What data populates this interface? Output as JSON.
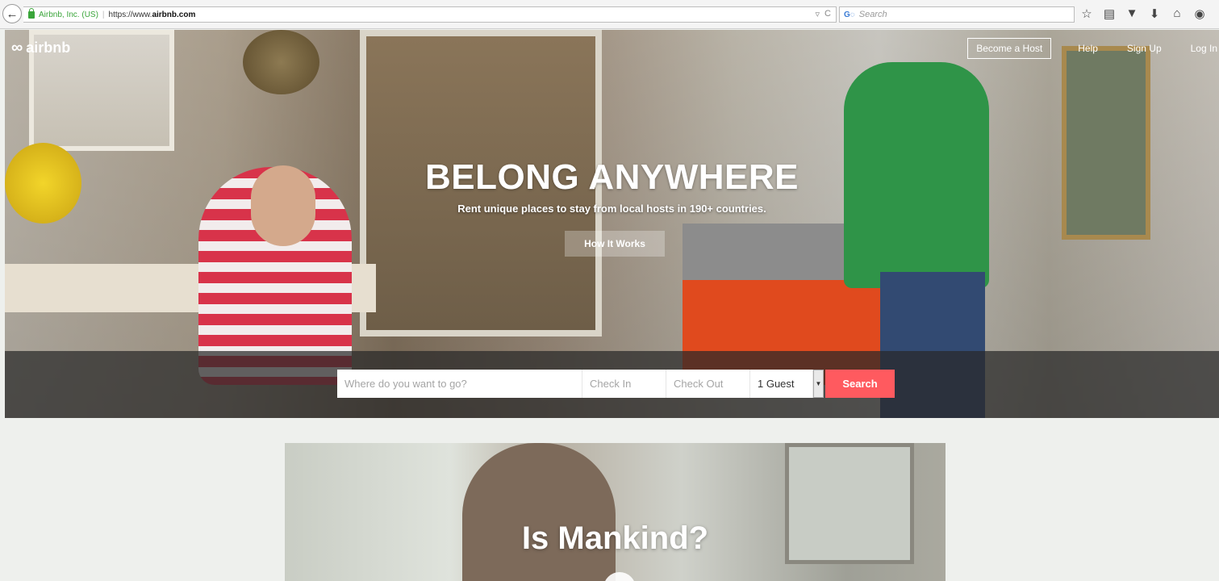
{
  "browser": {
    "site_identity": "Airbnb, Inc. (US)",
    "url_prefix": "https://www.",
    "url_domain": "airbnb.com",
    "search_placeholder": "Search",
    "reload_glyph": "C"
  },
  "header": {
    "logo_text": "airbnb",
    "nav": {
      "become_host": "Become a Host",
      "help": "Help",
      "sign_up": "Sign Up",
      "log_in": "Log In"
    }
  },
  "hero": {
    "headline": "BELONG ANYWHERE",
    "subheadline": "Rent unique places to stay from local hosts in 190+ countries.",
    "how_it_works": "How It Works"
  },
  "search": {
    "where_placeholder": "Where do you want to go?",
    "check_in_placeholder": "Check In",
    "check_out_placeholder": "Check Out",
    "guests_value": "1 Guest",
    "button_label": "Search"
  },
  "teaser": {
    "title": "Is Mankind?"
  },
  "colors": {
    "accent": "#ff5a5f",
    "secure_green": "#3aa53a",
    "page_bg": "#eef0ed"
  },
  "icons": [
    "back-arrow-icon",
    "lock-icon",
    "reload-icon",
    "search-engine-icon",
    "bookmark-star-icon",
    "reading-list-icon",
    "pocket-icon",
    "download-icon",
    "home-icon",
    "chat-icon",
    "airbnb-logo-icon",
    "play-icon"
  ]
}
